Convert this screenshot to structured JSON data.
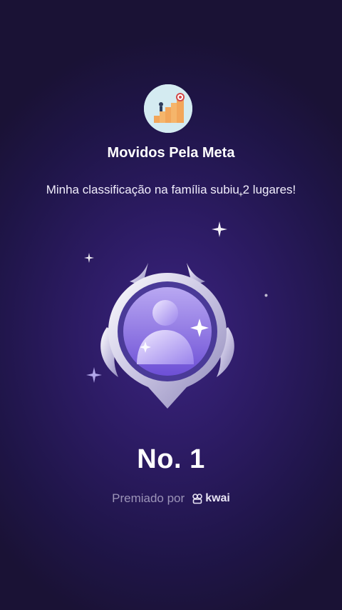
{
  "group": {
    "name": "Movidos Pela Meta",
    "avatar_icon": "stairs-goal-icon"
  },
  "message": "Minha classificação na família subiu 2 lugares!",
  "rank": "No. 1",
  "awarded": {
    "label": "Premiado por",
    "brand": "kwai",
    "brand_icon": "kwai-logo-icon"
  },
  "badge_icon": "user-rank-badge-icon",
  "colors": {
    "background": "#2c1b63",
    "text": "#ffffff",
    "muted": "#9c94b8"
  }
}
